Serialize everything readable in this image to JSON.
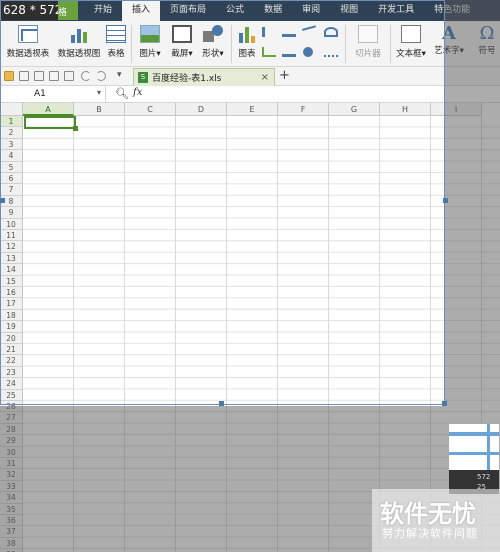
{
  "capture_size": "628 * 572",
  "capture_size_suffix": "格",
  "menu": {
    "items": [
      "开始",
      "插入",
      "页面布局",
      "公式",
      "数据",
      "审阅",
      "视图",
      "开发工具",
      "特色功能"
    ],
    "active": "插入"
  },
  "ribbon": {
    "pivot_table": "数据透视表",
    "pivot_chart": "数据透视图",
    "table": "表格",
    "picture": "图片",
    "screenshot": "截屏",
    "shapes": "形状",
    "chart": "图表",
    "slicer": "切片器",
    "textbox": "文本框",
    "wordart": "艺术字",
    "wordart_glyph": "A",
    "symbol": "符号",
    "symbol_glyph": "Ω"
  },
  "tab": {
    "file_name": "百度经验-表1.xls",
    "close": "×",
    "add": "+"
  },
  "formula_bar": {
    "name_box": "A1",
    "zoom_icon": "magnifier-icon",
    "fx": "fx"
  },
  "grid": {
    "columns": [
      "A",
      "B",
      "C",
      "D",
      "E",
      "F",
      "G",
      "H",
      "I"
    ],
    "rows": [
      "1",
      "2",
      "3",
      "4",
      "5",
      "6",
      "7",
      "8",
      "9",
      "10",
      "11",
      "12",
      "13",
      "14",
      "15",
      "16",
      "17",
      "18",
      "19",
      "20",
      "21",
      "22",
      "23",
      "24",
      "25",
      "26",
      "27",
      "28",
      "29",
      "30",
      "31",
      "32",
      "33",
      "34",
      "35",
      "36",
      "37",
      "38",
      "39"
    ],
    "selected_cell": "A1"
  },
  "thumbnail": {
    "line1": "572",
    "line2": "25"
  },
  "watermark": {
    "logo": "软件无忧",
    "subtitle": "努力解决软件问题"
  },
  "colors": {
    "menubar": "#2f4154",
    "selection_green": "#4d8a2e",
    "accent_blue": "#4a78a8"
  }
}
